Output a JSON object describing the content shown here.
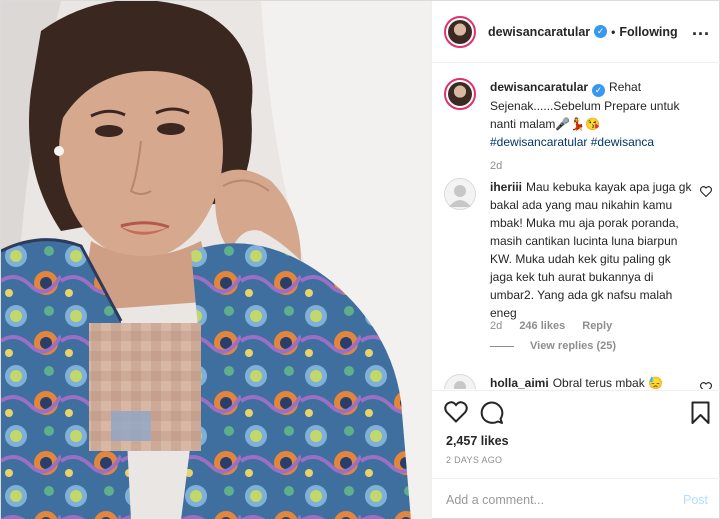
{
  "header": {
    "username": "dewisancaratular",
    "separator": "•",
    "follow_label": "Following",
    "more_label": "..."
  },
  "caption": {
    "username": "dewisancaratular",
    "text": "Rehat Sejenak......Sebelum Prepare untuk nanti malam🎤💃😘",
    "tags": "#dewisancaratular #dewisanca",
    "age": "2d"
  },
  "comments": [
    {
      "username": "iheriii",
      "text": "Mau kebuka kayak apa juga gk bakal ada yang mau nikahin kamu mbak! Muka mu aja porak poranda, masih cantikan lucinta luna biarpun KW. Muka udah kek gitu paling gk jaga kek tuh aurat bukannya di umbar2. Yang ada gk nafsu malah eneg",
      "age": "2d",
      "likes": "246 likes",
      "reply_label": "Reply",
      "view_replies": "View replies (25)"
    },
    {
      "username": "holla_aimi",
      "text": "Obral terus mbak 😓"
    }
  ],
  "actions": {
    "likes": "2,457 likes",
    "timestamp": "2 DAYS AGO"
  },
  "add_comment": {
    "placeholder": "Add a comment...",
    "post_label": "Post"
  },
  "icons": [
    "verified-badge-icon",
    "more-options-icon",
    "heart-icon",
    "comment-icon",
    "bookmark-icon"
  ],
  "colors": {
    "link": "#003569",
    "verified": "#3897f0",
    "post_disabled": "#b2dffc",
    "muted": "#8e8e8e"
  }
}
